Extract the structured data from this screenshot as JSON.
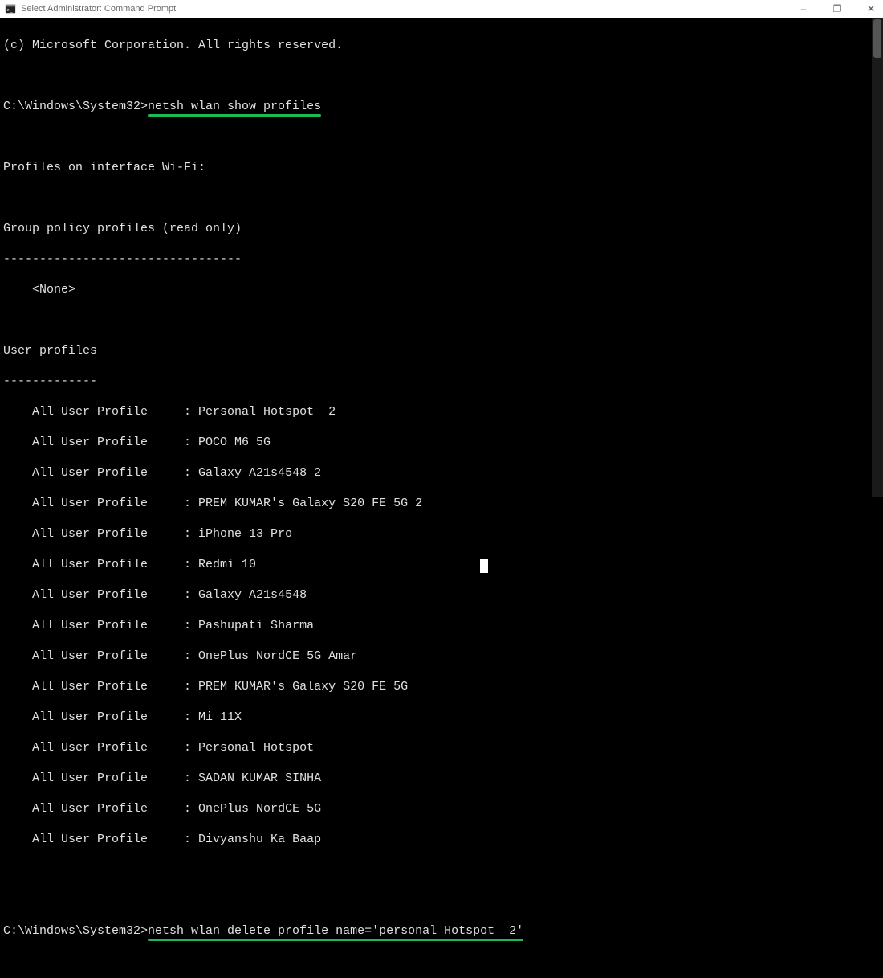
{
  "window": {
    "title": "Select Administrator: Command Prompt",
    "minimize": "–",
    "maximize": "❐",
    "close": "✕"
  },
  "copyright": "(c) Microsoft Corporation. All rights reserved.",
  "prompt1": {
    "path": "C:\\Windows\\System32>",
    "cmd": "netsh wlan show profiles"
  },
  "heading_interface": "Profiles on interface Wi-Fi:",
  "heading_group": "Group policy profiles (read only)",
  "dashes_group": "---------------------------------",
  "none": "    <None>",
  "heading_user": "User profiles",
  "dashes_user": "-------------",
  "profile_label": "    All User Profile     : ",
  "profiles": [
    "Personal Hotspot  2",
    "POCO M6 5G",
    "Galaxy A21s4548 2",
    "PREM KUMAR's Galaxy S20 FE 5G 2",
    "iPhone 13 Pro",
    "Redmi 10",
    "Galaxy A21s4548",
    "Pashupati Sharma",
    "OnePlus NordCE 5G Amar",
    "PREM KUMAR's Galaxy S20 FE 5G",
    "Mi 11X",
    "Personal Hotspot",
    "SADAN KUMAR SINHA",
    "OnePlus NordCE 5G",
    "Divyanshu Ka Baap"
  ],
  "prompt2": {
    "path": "C:\\Windows\\System32>",
    "cmd": "netsh wlan delete profile name='personal Hotspot  2'"
  }
}
